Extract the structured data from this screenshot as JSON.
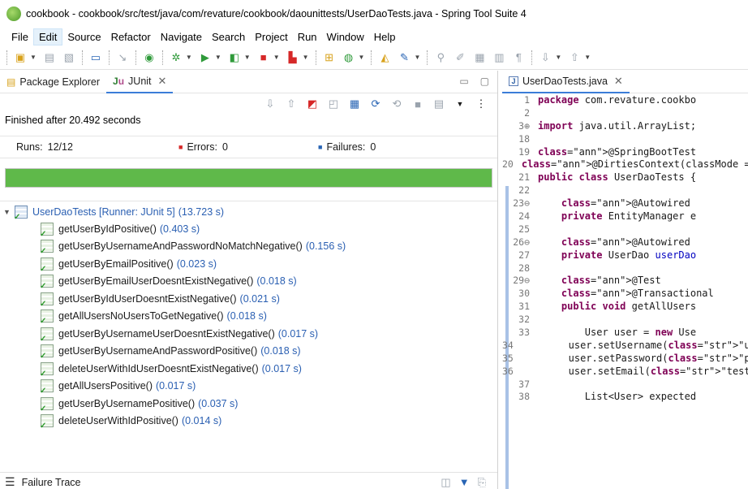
{
  "window": {
    "title": "cookbook - cookbook/src/test/java/com/revature/cookbook/daounittests/UserDaoTests.java - Spring Tool Suite 4"
  },
  "menu": [
    "File",
    "Edit",
    "Source",
    "Refactor",
    "Navigate",
    "Search",
    "Project",
    "Run",
    "Window",
    "Help"
  ],
  "left_panel": {
    "tabs": [
      {
        "label": "Package Explorer"
      },
      {
        "label": "JUnit"
      }
    ],
    "finished_text": "Finished after 20.492 seconds",
    "counters": {
      "runs_label": "Runs:",
      "runs_value": "12/12",
      "errors_label": "Errors:",
      "errors_value": "0",
      "failures_label": "Failures:",
      "failures_value": "0"
    },
    "progress": {
      "fraction": 1.0,
      "color": "#5fb94a"
    },
    "root": {
      "name": "UserDaoTests [Runner: JUnit 5]",
      "time": "(13.723 s)"
    },
    "tests": [
      {
        "name": "getUserByIdPositive()",
        "time": "(0.403 s)"
      },
      {
        "name": "getUserByUsernameAndPasswordNoMatchNegative()",
        "time": "(0.156 s)"
      },
      {
        "name": "getUserByEmailPositive()",
        "time": "(0.023 s)"
      },
      {
        "name": "getUserByEmailUserDoesntExistNegative()",
        "time": "(0.018 s)"
      },
      {
        "name": "getUserByIdUserDoesntExistNegative()",
        "time": "(0.021 s)"
      },
      {
        "name": "getAllUsersNoUsersToGetNegative()",
        "time": "(0.018 s)"
      },
      {
        "name": "getUserByUsernameUserDoesntExistNegative()",
        "time": "(0.017 s)"
      },
      {
        "name": "getUserByUsernameAndPasswordPositive()",
        "time": "(0.018 s)"
      },
      {
        "name": "deleteUserWithIdUserDoesntExistNegative()",
        "time": "(0.017 s)"
      },
      {
        "name": "getAllUsersPositive()",
        "time": "(0.017 s)"
      },
      {
        "name": "getUserByUsernamePositive()",
        "time": "(0.037 s)"
      },
      {
        "name": "deleteUserWithIdPositive()",
        "time": "(0.014 s)"
      }
    ],
    "failure_trace_label": "Failure Trace"
  },
  "editor": {
    "tab_label": "UserDaoTests.java",
    "lines": [
      {
        "n": "1",
        "code": "package com.revature.cookbo"
      },
      {
        "n": "2",
        "code": ""
      },
      {
        "n": "3⊕",
        "code": "import java.util.ArrayList;"
      },
      {
        "n": "18",
        "code": ""
      },
      {
        "n": "19",
        "code": "@SpringBootTest"
      },
      {
        "n": "20",
        "code": "@DirtiesContext(classMode ="
      },
      {
        "n": "21",
        "code": "public class UserDaoTests {"
      },
      {
        "n": "22",
        "code": ""
      },
      {
        "n": "23⊖",
        "code": "    @Autowired"
      },
      {
        "n": "24",
        "code": "    private EntityManager e"
      },
      {
        "n": "25",
        "code": ""
      },
      {
        "n": "26⊖",
        "code": "    @Autowired"
      },
      {
        "n": "27",
        "code": "    private UserDao userDao"
      },
      {
        "n": "28",
        "code": ""
      },
      {
        "n": "29⊖",
        "code": "    @Test"
      },
      {
        "n": "30",
        "code": "    @Transactional"
      },
      {
        "n": "31",
        "code": "    public void getAllUsers"
      },
      {
        "n": "32",
        "code": ""
      },
      {
        "n": "33",
        "code": "        User user = new Use"
      },
      {
        "n": "34",
        "code": "        user.setUsername(\"u"
      },
      {
        "n": "35",
        "code": "        user.setPassword(\"p"
      },
      {
        "n": "36",
        "code": "        user.setEmail(\"test"
      },
      {
        "n": "37",
        "code": ""
      },
      {
        "n": "38",
        "code": "        List<User> expected"
      }
    ]
  },
  "colors": {
    "progress": "#5fb94a",
    "time_text": "#2a5fb2",
    "keyword": "#7f0055"
  }
}
